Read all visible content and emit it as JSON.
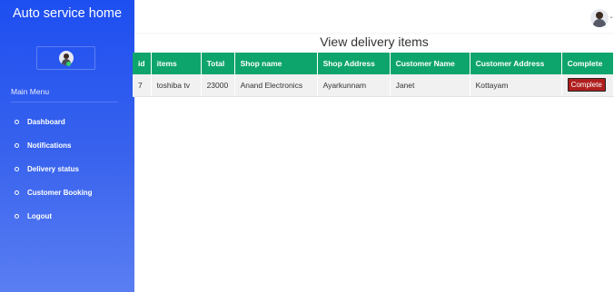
{
  "app": {
    "title": "Auto service home"
  },
  "sidebar": {
    "menu_title": "Main Menu",
    "items": [
      {
        "label": "Dashboard"
      },
      {
        "label": "Notifications"
      },
      {
        "label": "Delivery status"
      },
      {
        "label": "Customer Booking"
      },
      {
        "label": "Logout"
      }
    ]
  },
  "page": {
    "title": "View delivery items"
  },
  "table": {
    "headers": [
      "id",
      "items",
      "Total",
      "Shop name",
      "Shop Address",
      "Customer Name",
      "Customer Address",
      "Complete"
    ],
    "rows": [
      {
        "id": "7",
        "items": "toshiba tv",
        "total": "23000",
        "shop_name": "Anand Electronics",
        "shop_address": "Ayarkunnam",
        "customer_name": "Janet",
        "customer_address": "Kottayam",
        "action": "Complete"
      }
    ]
  },
  "colors": {
    "sidebar_top": "#1d4ef0",
    "sidebar_bottom": "#5a7ef2",
    "table_header": "#0ea56c",
    "complete_button": "#b01e1e",
    "online_status": "#2fd36b"
  },
  "icons": {
    "sidebar_avatar": "user-avatar-icon",
    "topbar_avatar": "user-avatar-icon",
    "menu_bullet": "ring-bullet-icon",
    "dropdown": "chevron-down-icon"
  }
}
